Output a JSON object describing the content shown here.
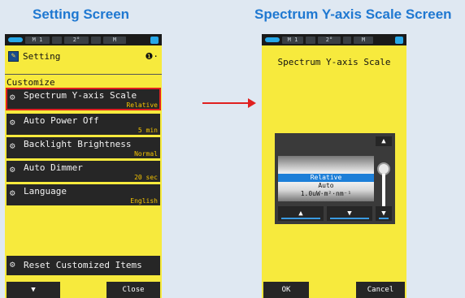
{
  "captions": {
    "left": "Setting Screen",
    "right": "Spectrum Y-axis Scale Screen"
  },
  "left_screen": {
    "status": {
      "cell1": "M 1",
      "cell2": "2°",
      "cell3": "M"
    },
    "header": {
      "icon": "settings-wrench-icon",
      "title": "Setting",
      "page": "❶·"
    },
    "section": "Customize",
    "menu": [
      {
        "label": "Spectrum Y-axis Scale",
        "value": "Relative",
        "selected": true
      },
      {
        "label": "Auto Power Off",
        "value": "5 min"
      },
      {
        "label": "Backlight Brightness",
        "value": "Normal"
      },
      {
        "label": "Auto Dimmer",
        "value": "20 sec"
      },
      {
        "label": "Language",
        "value": "English"
      }
    ],
    "reset_label": "Reset Customized Items",
    "buttons": {
      "down": "▼",
      "close": "Close"
    }
  },
  "right_screen": {
    "status": {
      "cell1": "M 1",
      "cell2": "2°",
      "cell3": "M"
    },
    "title": "Spectrum Y-axis Scale",
    "options": [
      "Relative",
      "Auto",
      "1.0uW·m²·nm⁻¹"
    ],
    "selected_option": "Relative",
    "controls": {
      "top": "▲",
      "up": "▲",
      "down": "▼",
      "bottom": "▼"
    },
    "buttons": {
      "ok": "OK",
      "cancel": "Cancel"
    }
  },
  "colors": {
    "caption": "#1f78d1",
    "screen_bg": "#f7ea3d",
    "item_bg": "#262626",
    "value_text": "#f5c400",
    "highlight": "#e02020",
    "selected_row": "#1d7fd8"
  }
}
